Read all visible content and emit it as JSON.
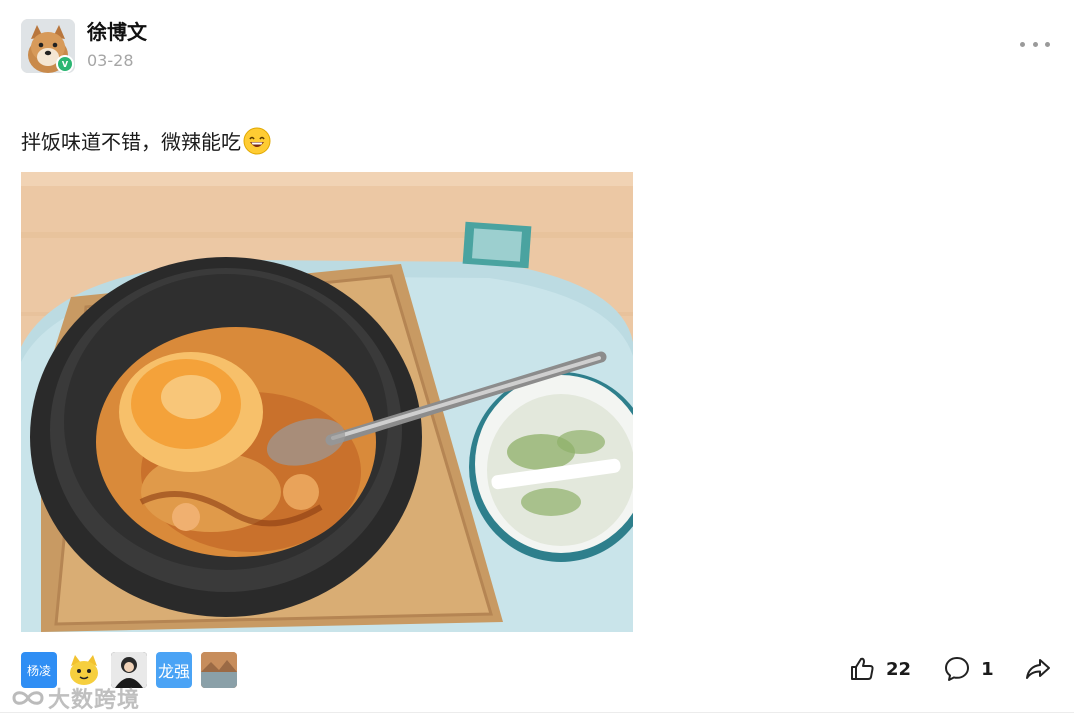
{
  "post": {
    "author": "徐博文",
    "date": "03-28",
    "text": "拌饭味道不错，微辣能吃",
    "emoji": "grinning-face-emoji",
    "badge": "V"
  },
  "photo": {
    "subject": "stone-pot-bibimbap-with-soup"
  },
  "likers": [
    {
      "label": "杨凌"
    },
    {
      "label": ""
    },
    {
      "label": ""
    },
    {
      "label": "龙强"
    },
    {
      "label": ""
    }
  ],
  "actions": {
    "like_count": "22",
    "comment_count": "1"
  },
  "watermark": "大数跨境",
  "colors": {
    "verified_badge": "#2bb673",
    "liker_blue": "#2f8ef4",
    "text_gray": "#a6a6a6"
  }
}
